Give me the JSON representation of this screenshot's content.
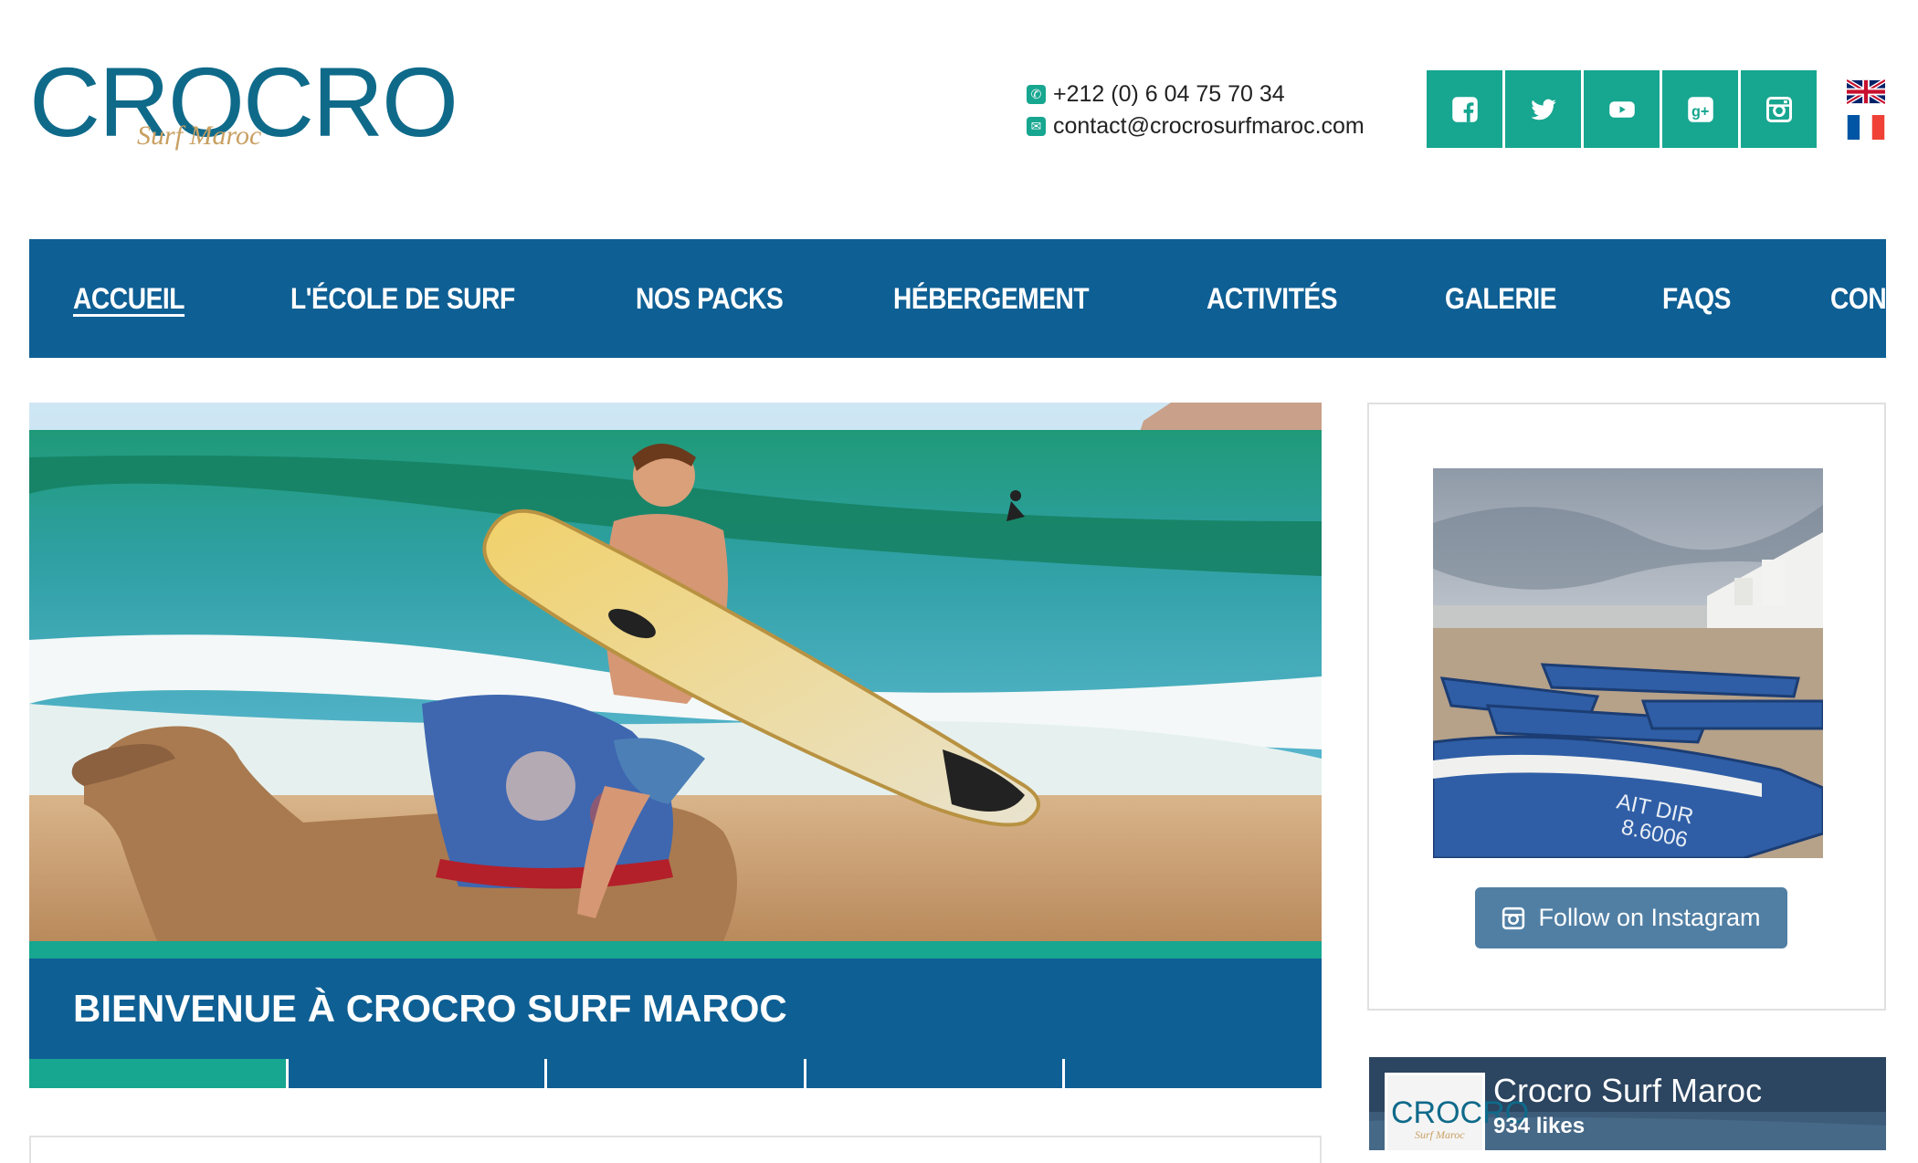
{
  "brand": {
    "logo_text": "CROCRO",
    "logo_sub": "Surf Maroc"
  },
  "contact": {
    "phone": "+212 (0) 6 04 75 70 34",
    "email": "contact@crocrosurfmaroc.com"
  },
  "social": [
    "facebook-icon",
    "twitter-icon",
    "youtube-icon",
    "google-plus-icon",
    "instagram-icon"
  ],
  "languages": [
    "English",
    "Français"
  ],
  "nav": {
    "items": [
      "ACCUEIL",
      "L'ÉCOLE DE SURF",
      "NOS PACKS",
      "HÉBERGEMENT",
      "ACTIVITÉS",
      "GALERIE",
      "FAQS",
      "CONTACT"
    ],
    "active_index": 0
  },
  "hero": {
    "title": "BIENVENUE À CROCRO SURF MAROC",
    "slide_count": 5,
    "active_slide": 0
  },
  "instagram": {
    "follow_label": "Follow on Instagram",
    "boat_text_1": "AIT DIR",
    "boat_text_2": "8.6006"
  },
  "facebook": {
    "page_name": "Crocro Surf Maroc",
    "likes": "934 likes"
  },
  "colors": {
    "nav_blue": "#0e5f94",
    "teal": "#17a690",
    "insta_blue": "#517fa4"
  }
}
